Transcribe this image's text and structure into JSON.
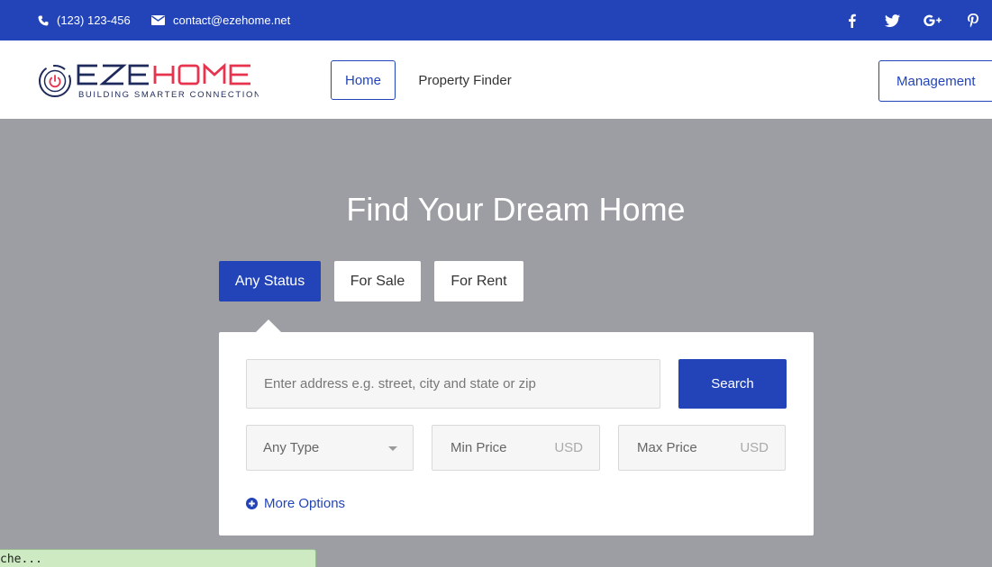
{
  "topbar": {
    "phone": "(123) 123-456",
    "email": "contact@ezehome.net",
    "social": [
      {
        "icon": "facebook-icon",
        "glyph": "f"
      },
      {
        "icon": "twitter-icon",
        "glyph": "t"
      },
      {
        "icon": "google-plus-icon",
        "glyph": "G+"
      },
      {
        "icon": "pinterest-icon",
        "glyph": "p"
      }
    ]
  },
  "logo": {
    "wordmark": "EZEHOME",
    "tagline": "BUILDING SMARTER CONNECTIONS"
  },
  "nav": {
    "home": "Home",
    "property_finder": "Property Finder",
    "management": "Management"
  },
  "hero": {
    "title": "Find Your Dream Home",
    "tabs": [
      "Any Status",
      "For Sale",
      "For Rent"
    ],
    "active_tab": "Any Status"
  },
  "search": {
    "address_placeholder": "Enter address e.g. street, city and state or zip",
    "button": "Search",
    "type_selected": "Any Type",
    "min_price_placeholder": "Min Price",
    "max_price_placeholder": "Max Price",
    "currency": "USD",
    "more_options": "More Options"
  },
  "statusbar": {
    "text": "che..."
  },
  "colors": {
    "brand_blue": "#2244b8",
    "logo_red": "#e8334f",
    "hero_bg": "#9d9ea3",
    "statusbar_bg": "#cdeac3"
  }
}
